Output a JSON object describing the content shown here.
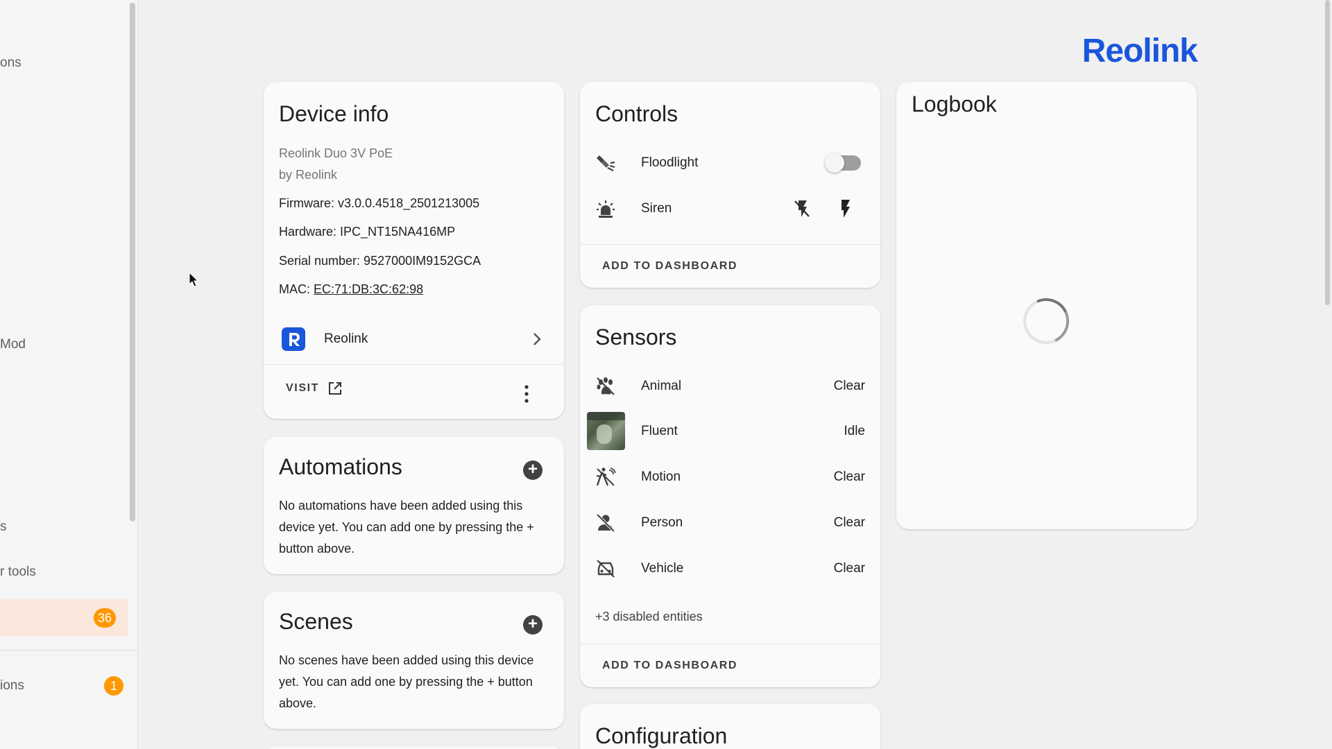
{
  "sidebar": {
    "items": [
      {
        "label": "ons"
      },
      {
        "label": "Mod"
      },
      {
        "label": "s"
      },
      {
        "label": "r tools"
      },
      {
        "label": "",
        "badge": "36"
      },
      {
        "label": "ions",
        "badge": "1"
      }
    ]
  },
  "brand": {
    "logo_text": "Reolink",
    "color": "#1a56db"
  },
  "device_info": {
    "title": "Device info",
    "model": "Reolink Duo 3V PoE",
    "manufacturer": "by Reolink",
    "firmware": "Firmware: v3.0.0.4518_2501213005",
    "hardware": "Hardware: IPC_NT15NA416MP",
    "serial": "Serial number: 9527000IM9152GCA",
    "mac_label": "MAC: ",
    "mac_value": "EC:71:DB:3C:62:98",
    "integration": "Reolink",
    "visit": "VISIT"
  },
  "automations": {
    "title": "Automations",
    "text": "No automations have been added using this device yet. You can add one by pressing the + button above."
  },
  "scenes": {
    "title": "Scenes",
    "text": "No scenes have been added using this device yet. You can add one by pressing the + button above."
  },
  "controls": {
    "title": "Controls",
    "items": [
      {
        "label": "Floodlight",
        "icon": "spotlight-icon",
        "state": "off"
      },
      {
        "label": "Siren",
        "icon": "alarm-light-icon"
      }
    ],
    "add_to_dashboard": "ADD TO DASHBOARD"
  },
  "sensors": {
    "title": "Sensors",
    "items": [
      {
        "label": "Animal",
        "value": "Clear",
        "icon": "paw-icon"
      },
      {
        "label": "Fluent",
        "value": "Idle",
        "icon": "camera-thumbnail"
      },
      {
        "label": "Motion",
        "value": "Clear",
        "icon": "motion-sensor-icon"
      },
      {
        "label": "Person",
        "value": "Clear",
        "icon": "account-off-icon"
      },
      {
        "label": "Vehicle",
        "value": "Clear",
        "icon": "car-off-icon"
      }
    ],
    "disabled": "+3 disabled entities",
    "add_to_dashboard": "ADD TO DASHBOARD"
  },
  "configuration": {
    "title": "Configuration"
  },
  "logbook": {
    "title": "Logbook"
  }
}
